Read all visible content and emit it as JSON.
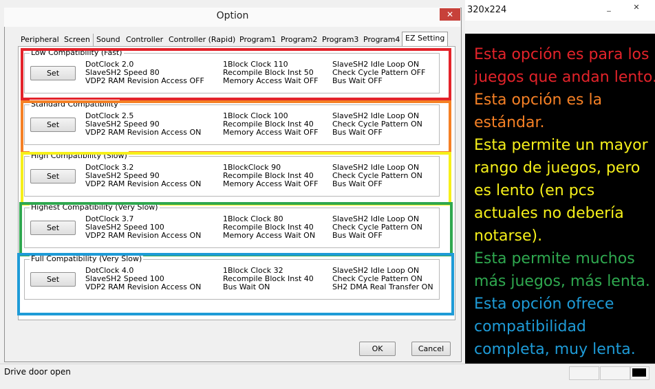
{
  "host": {
    "resolution": "320x224",
    "minimize": "_",
    "maximize": "□",
    "close": "✕"
  },
  "status": {
    "text": "Drive door open"
  },
  "dialog": {
    "title": "Option",
    "close": "✕",
    "tabs": [
      "Peripheral",
      "Screen",
      "Sound",
      "Controller",
      "Controller (Rapid)",
      "Program1",
      "Program2",
      "Program3",
      "Program4",
      "EZ Setting"
    ],
    "active_tab": "EZ Setting",
    "ok": "OK",
    "cancel": "Cancel",
    "groups": [
      {
        "title": "Low Compatibility (Fast)",
        "set": "Set",
        "col1": [
          "DotClock 2.0",
          "SlaveSH2 Speed 80",
          "VDP2 RAM Revision Access OFF"
        ],
        "col2": [
          "1Block Clock 110",
          "Recompile Block Inst 50",
          "Memory Access Wait OFF"
        ],
        "col3": [
          "SlaveSH2 Idle Loop ON",
          "Check Cycle Pattern OFF",
          "Bus Wait OFF"
        ],
        "highlight_color": "#e3232a"
      },
      {
        "title": "Standard Compatibility",
        "set": "Set",
        "col1": [
          "DotClock 2.5",
          "SlaveSH2 Speed 90",
          "VDP2 RAM Revision Access ON"
        ],
        "col2": [
          "1Block Clock 100",
          "Recompile Block Inst 40",
          "Memory Access Wait OFF"
        ],
        "col3": [
          "SlaveSH2 Idle Loop ON",
          "Check Cycle Pattern ON",
          "Bus Wait OFF"
        ],
        "highlight_color": "#f58025"
      },
      {
        "title": "High Compatibility (Slow)",
        "set": "Set",
        "col1": [
          "DotClock 3.2",
          "SlaveSH2 Speed 90",
          "VDP2 RAM Revision Access ON"
        ],
        "col2": [
          "1BlockClock 90",
          "Recompile Block Inst 40",
          "Memory Access Wait OFF"
        ],
        "col3": [
          "SlaveSH2 Idle Loop ON",
          "Check Cycle Pattern ON",
          "Bus Wait OFF"
        ],
        "highlight_color": "#f6f01a"
      },
      {
        "title": "Highest Compatibility (Very Slow)",
        "set": "Set",
        "col1": [
          "DotClock 3.7",
          "SlaveSH2 Speed 100",
          "VDP2 RAM Revision Access ON"
        ],
        "col2": [
          "1Block Clock 80",
          "Recompile Block Inst 40",
          "Memory Access Wait ON"
        ],
        "col3": [
          "SlaveSH2 Idle Loop ON",
          "Check Cycle Pattern ON",
          "Bus Wait OFF"
        ],
        "highlight_color": "#2fa84f"
      },
      {
        "title": "Full Compatibility (Very Slow)",
        "set": "Set",
        "col1": [
          "DotClock 4.0",
          "SlaveSH2 Speed 100",
          "VDP2 RAM Revision Access ON"
        ],
        "col2": [
          "1Block Clock 32",
          "Recompile Block Inst 40",
          "Bus Wait ON"
        ],
        "col3": [
          "SlaveSH2 Idle Loop ON",
          "Check Cycle Pattern ON",
          "SH2 DMA Real Transfer ON"
        ],
        "highlight_color": "#1e9bd7"
      }
    ]
  },
  "notes": [
    {
      "lines": [
        "Esta opción es para los",
        "juegos que andan lento."
      ],
      "color": "#e3232a"
    },
    {
      "lines": [
        "Esta opción es la",
        "estándar."
      ],
      "color": "#f58025"
    },
    {
      "lines": [
        "Esta permite un mayor",
        "rango de juegos, pero",
        "es lento (en pcs",
        "actuales no debería",
        "notarse)."
      ],
      "color": "#f6f01a"
    },
    {
      "lines": [
        "Esta permite muchos",
        "más juegos, más lenta."
      ],
      "color": "#2fa84f"
    },
    {
      "lines": [
        "Esta opción ofrece",
        "compatibilidad",
        "completa, muy lenta."
      ],
      "color": "#1e9bd7"
    }
  ]
}
